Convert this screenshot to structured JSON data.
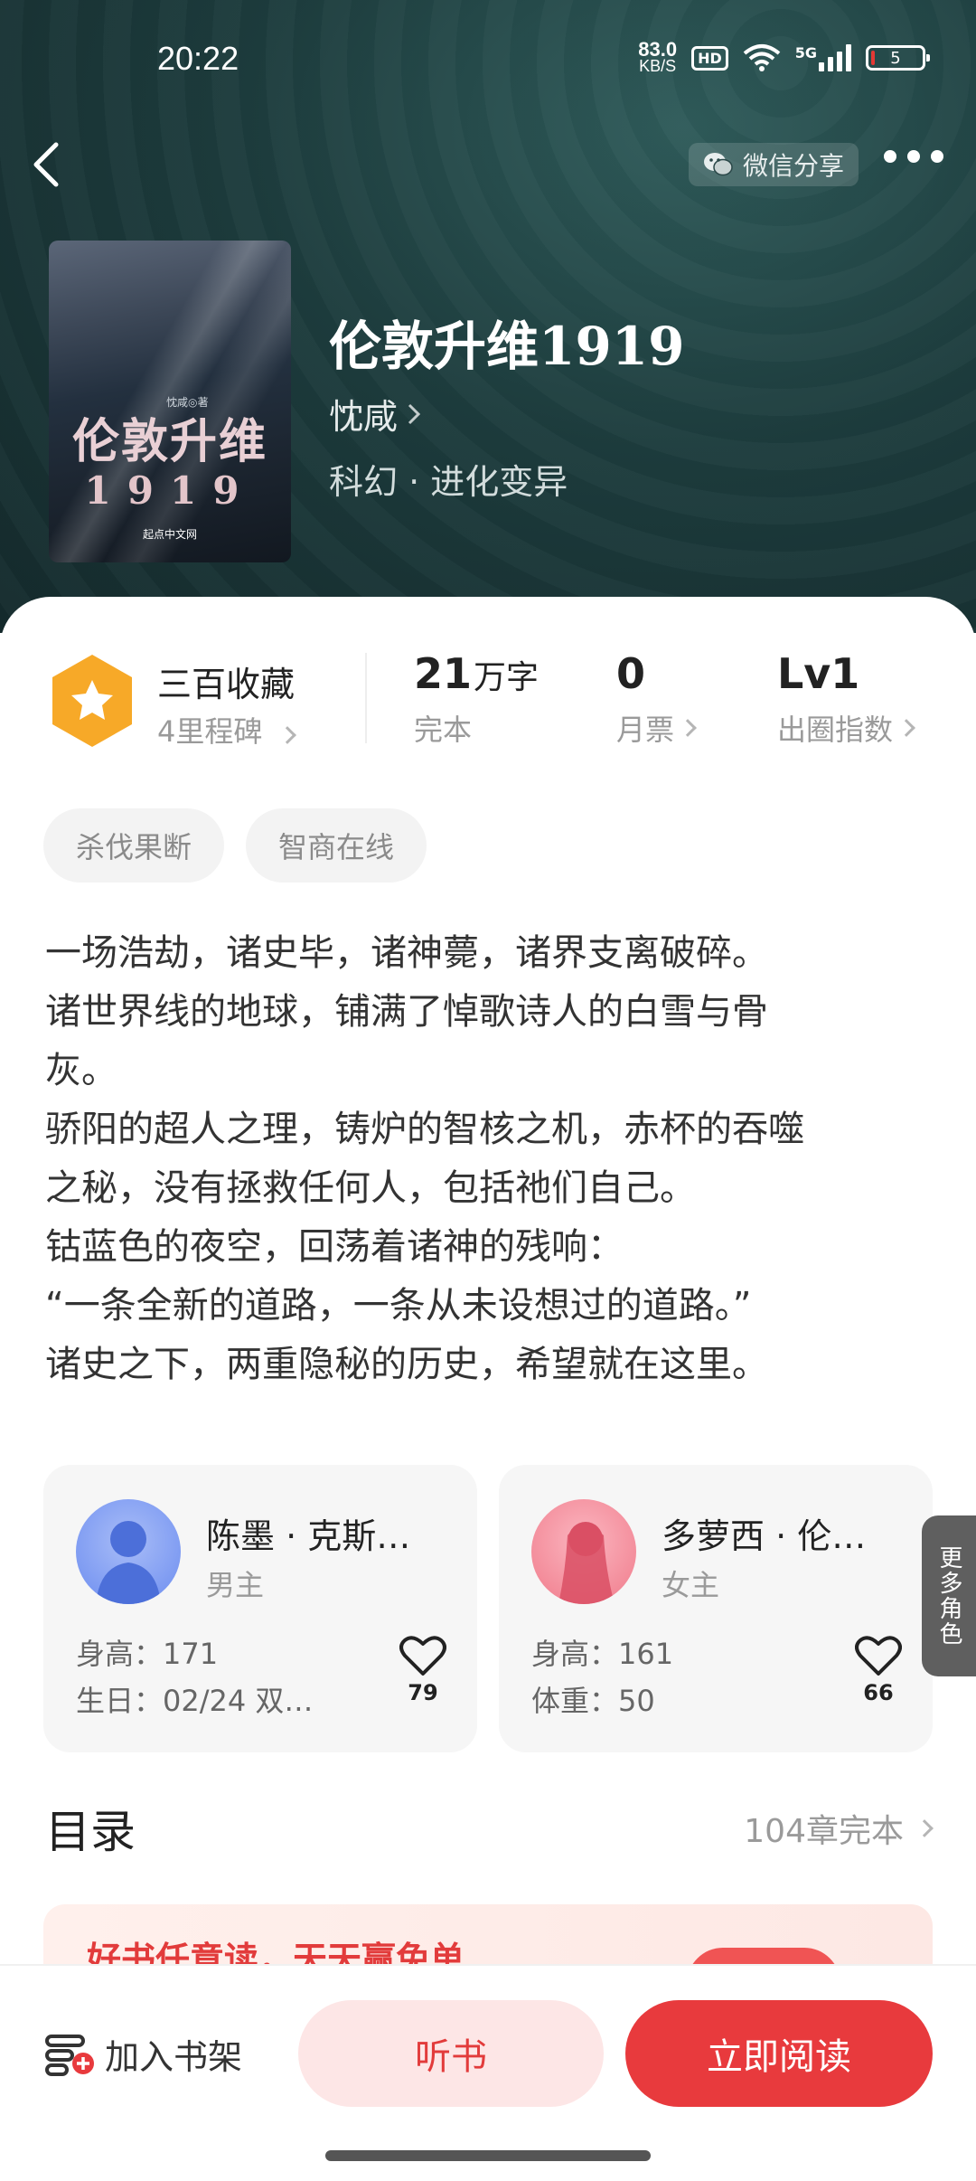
{
  "status_bar": {
    "time": "20:22",
    "net_speed_value": "83.0",
    "net_speed_unit": "KB/S",
    "hd": "HD",
    "network": "5G",
    "battery": "5"
  },
  "header": {
    "share_label": "微信分享",
    "back_icon": "chevron-left-icon",
    "more_icon": "more-dots-icon"
  },
  "book": {
    "title": "伦敦升维1919",
    "author": "忱咸",
    "genre": "科幻 · 进化变异",
    "cover": {
      "title": "伦敦升维",
      "year": "1919",
      "author": "忱咸◎著",
      "publisher": "起点中文网"
    }
  },
  "stats": {
    "favorites_title": "三百收藏",
    "favorites_sub": "4里程碑",
    "word_count_value": "21",
    "word_count_unit": "万字",
    "word_count_label": "完本",
    "monthly_ticket_value": "0",
    "monthly_ticket_label": "月票",
    "circle_index_value": "Lv1",
    "circle_index_label": "出圈指数",
    "badge_color": "#f7a928"
  },
  "tags": [
    "杀伐果断",
    "智商在线"
  ],
  "synopsis": [
    "一场浩劫，诸史毕，诸神薨，诸界支离破碎。",
    "诸世界线的地球，铺满了悼歌诗人的白雪与骨",
    "灰。",
    "骄阳的超人之理，铸炉的智核之机，赤杯的吞噬",
    "之秘，没有拯救任何人，包括祂们自己。",
    "钴蓝色的夜空，回荡着诸神的残响：",
    "“一条全新的道路，一条从未设想过的道路。”",
    "诸史之下，两重隐秘的历史，希望就在这里。"
  ],
  "characters": [
    {
      "name": "陈墨 · 克斯…",
      "role": "男主",
      "attr1": "身高：171",
      "attr2": "生日：02/24 双…",
      "likes": "79",
      "avatar_color": "#6b8cf0"
    },
    {
      "name": "多萝西 · 伦…",
      "role": "女主",
      "attr1": "身高：161",
      "attr2": "体重：50",
      "likes": "66",
      "avatar_color": "#f07a8a"
    }
  ],
  "more_roles": "更多角色",
  "toc": {
    "title": "目录",
    "info": "104章完本"
  },
  "promo": {
    "text": "好书任意读，天天赢免单"
  },
  "bottom": {
    "shelf_label": "加入书架",
    "listen_label": "听书",
    "read_label": "立即阅读",
    "accent": "#e83a3d"
  }
}
